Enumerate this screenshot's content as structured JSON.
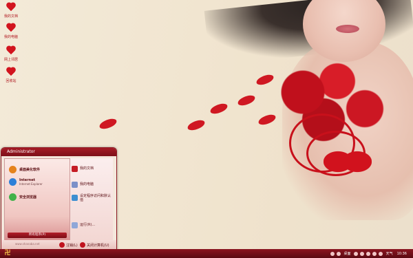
{
  "desktop_icons": [
    {
      "label": "我的文档"
    },
    {
      "label": "我的电脑"
    },
    {
      "label": "网上邻居"
    },
    {
      "label": "回收站"
    }
  ],
  "start_menu": {
    "user": "Administrator",
    "pinned": [
      {
        "title": "桌面美化软件",
        "subtitle": "",
        "color": "#e5831d"
      },
      {
        "title": "Internet",
        "subtitle": "Internet Explorer",
        "color": "#2d7fd8"
      },
      {
        "title": "安全浏览器",
        "subtitle": "",
        "color": "#41b24a"
      }
    ],
    "all_programs": "所有程序(P)",
    "right_items": [
      {
        "label": "我的文档"
      },
      {
        "label": "我的电脑"
      },
      {
        "label": "设定程序访问和默认值"
      },
      {
        "label": "运行(R)..."
      }
    ],
    "logoff": "注销(L)",
    "shutdown": "关闭计算机(U)",
    "watermark": "www.shanaba.net"
  },
  "taskbar": {
    "start_glyph": "卍",
    "desktop_label": "桌面",
    "weather_label": "天气",
    "clock": "10:36"
  }
}
